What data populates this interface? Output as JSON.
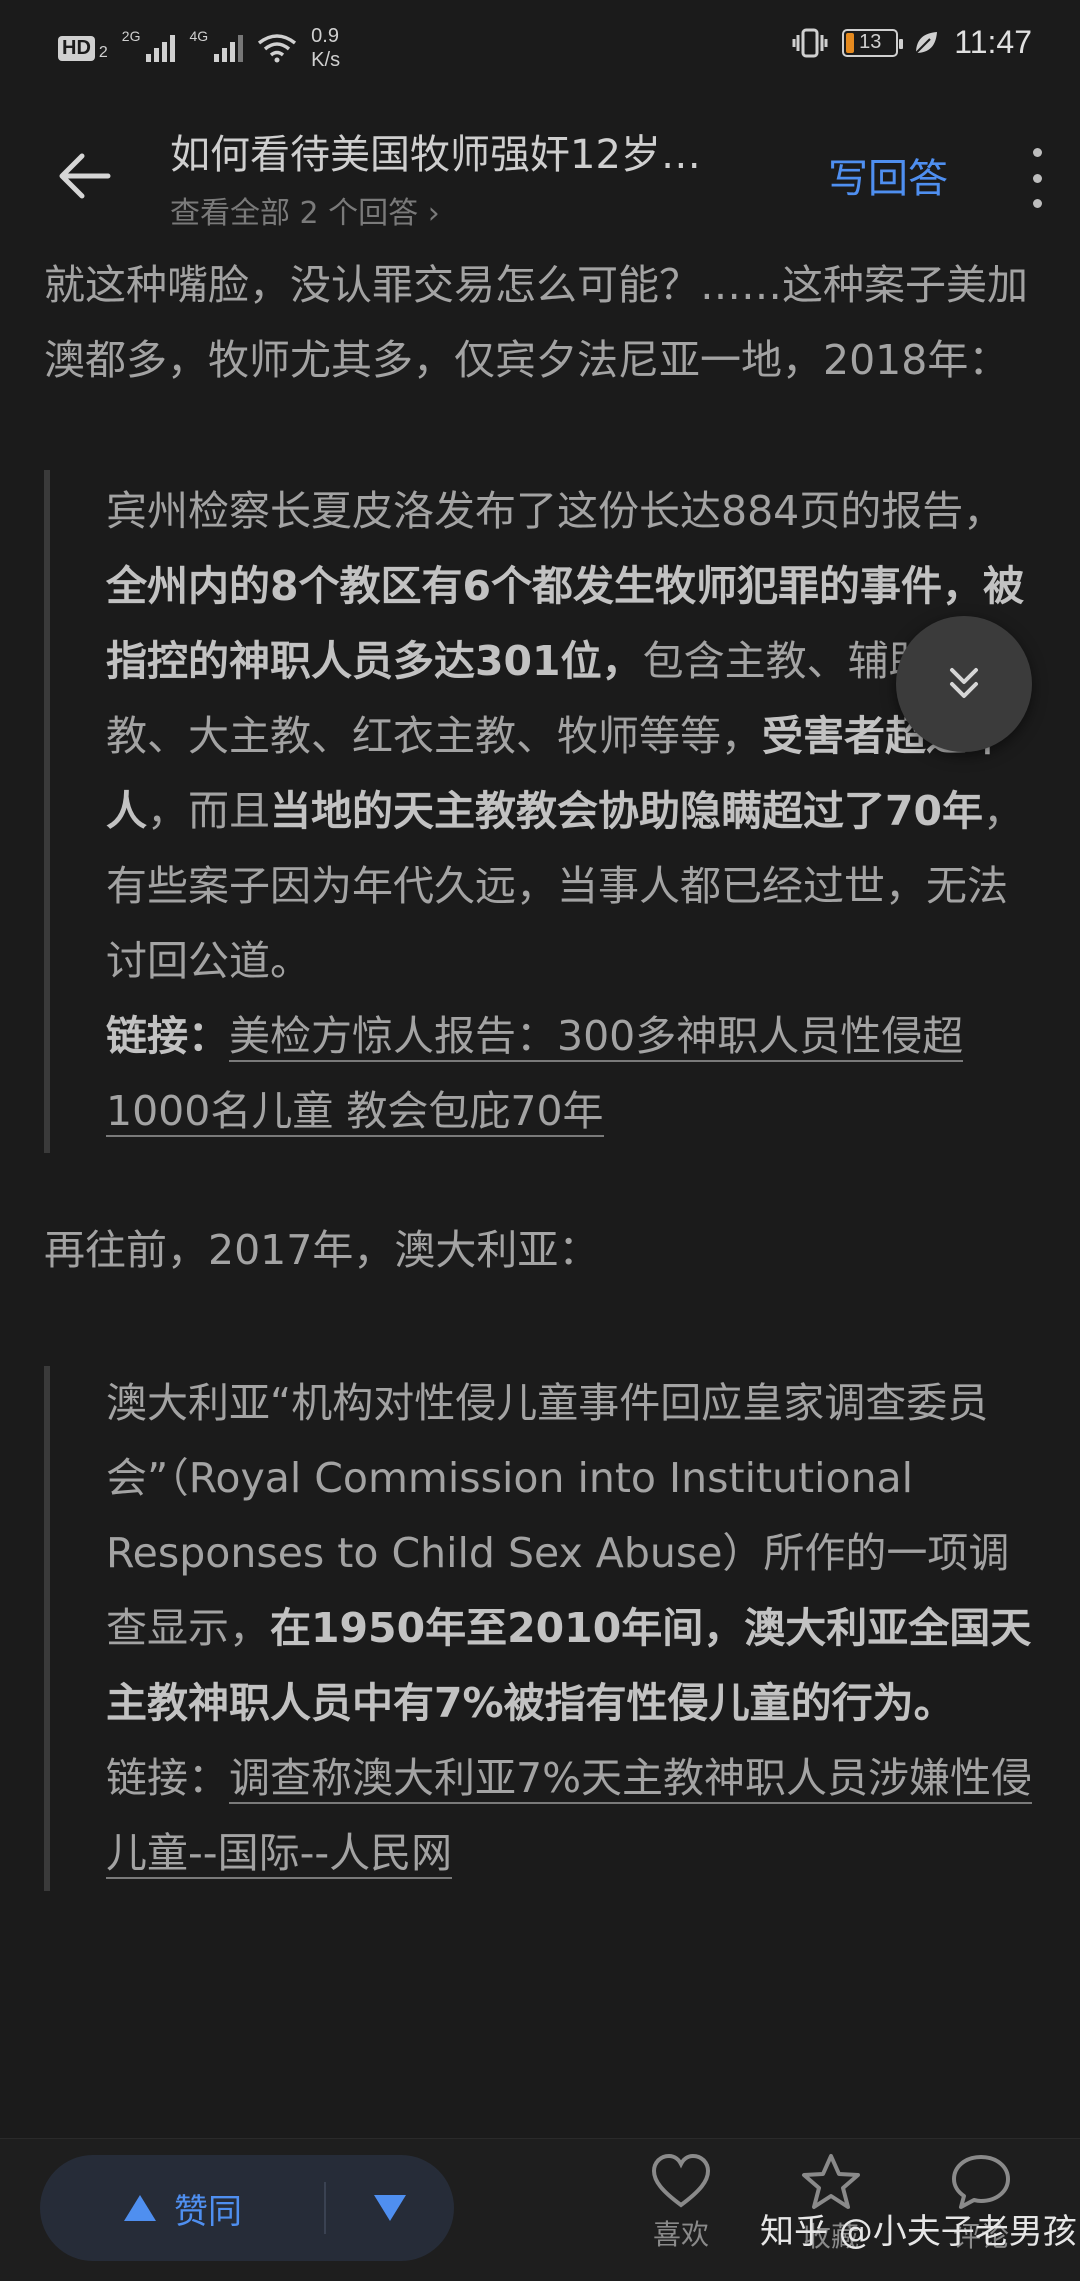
{
  "status_bar": {
    "hd_label": "HD",
    "hd_sub": "2",
    "net1": "2G",
    "net2": "4G",
    "speed_value": "0.9",
    "speed_unit": "K/s",
    "battery_level": "13",
    "time": "11:47"
  },
  "header": {
    "title": "如何看待美国牧师强奸12岁…",
    "subtitle": "查看全部 2 个回答 ›",
    "write_answer": "写回答"
  },
  "content": {
    "p1": "就这种嘴脸，没认罪交易怎么可能？……这种案子美加澳都多，牧师尤其多，仅宾夕法尼亚一地，2018年：",
    "q1_a": "宾州检察长夏皮洛发布了这份长达884页的报告，",
    "q1_b": "全州内的8个教区有6个都发生牧师犯罪的事件，被指控的神职人员多达301位，",
    "q1_c": "包含主教、辅助主教、大主教、红衣主教、牧师等等，",
    "q1_d": "受害者超过千人",
    "q1_e": "，而且",
    "q1_f": "当地的天主教教会协助隐瞒超过了70年",
    "q1_g": "，有些案子因为年代久远，当事人都已经过世，无法讨回公道。",
    "q1_link_label": "链接：",
    "q1_link": "美检方惊人报告：300多神职人员性侵超1000名儿童 教会包庇70年",
    "p2": "再往前，2017年，澳大利亚：",
    "q2_a": "澳大利亚“机构对性侵儿童事件回应皇家调查委员会”（Royal Commission into Institutional Responses to Child Sex Abuse）所作的一项调查显示，",
    "q2_b": "在1950年至2010年间，澳大利亚全国天主教神职人员中有7%被指有性侵儿童的行为。",
    "q2_link_label": "链接：",
    "q2_link": "调查称澳大利亚7%天主教神职人员涉嫌性侵儿童--国际--人民网"
  },
  "bottom_bar": {
    "upvote": "赞同",
    "like": "喜欢",
    "favorite": "收藏",
    "comment": "评论"
  },
  "watermark": "知乎 @小夫子老男孩",
  "colors": {
    "accent": "#4f8ff0",
    "background": "#1b1b1b",
    "text": "#a3a3a3"
  },
  "icons": [
    "back-arrow-icon",
    "more-vert-icon",
    "double-chevron-down-icon",
    "triangle-up-icon",
    "triangle-down-icon",
    "heart-icon",
    "star-icon",
    "comment-bubble-icon"
  ]
}
